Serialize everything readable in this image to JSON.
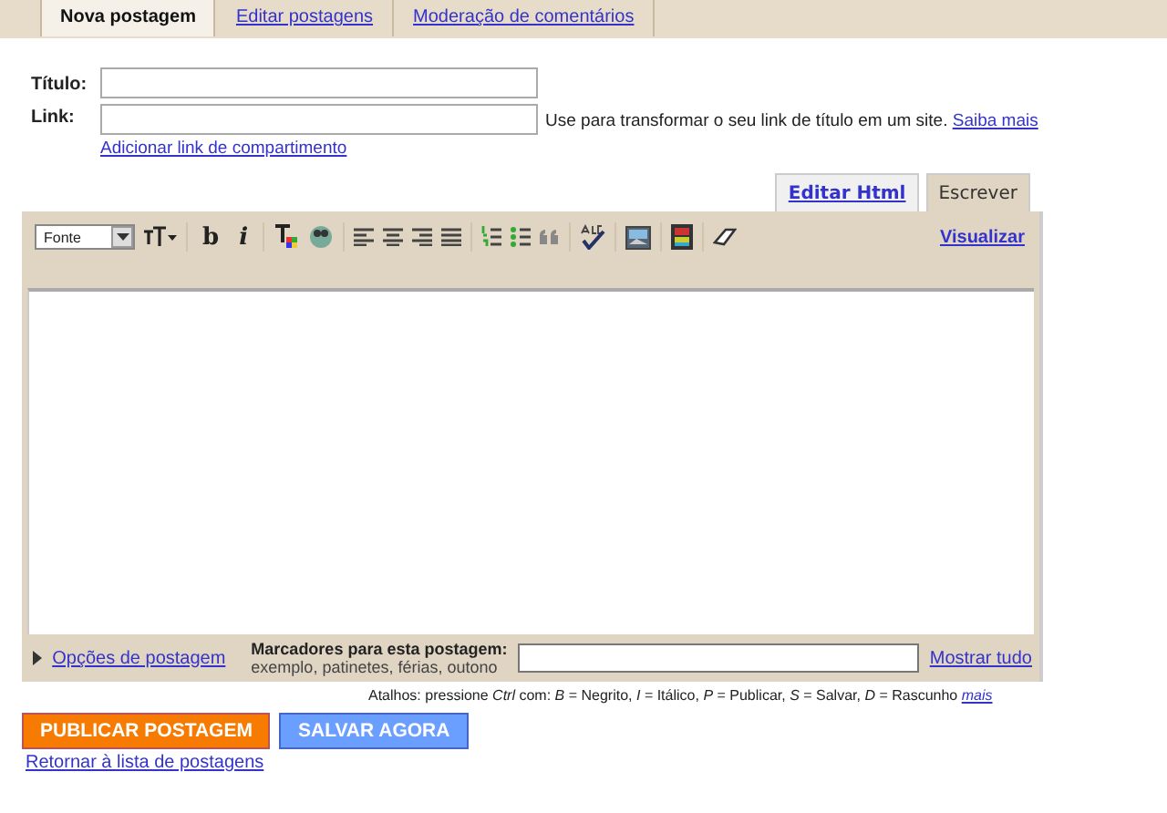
{
  "tabs": [
    {
      "label": "Nova postagem",
      "selected": true
    },
    {
      "label": "Editar postagens",
      "selected": false
    },
    {
      "label": "Moderação de comentários",
      "selected": false
    }
  ],
  "form": {
    "title_label": "Título:",
    "link_label": "Link:",
    "link_hint": "Use para transformar o seu link de título em um site.",
    "learn_more": "Saiba mais",
    "add_share_link": "Adicionar link de compartimento"
  },
  "editor_tabs": [
    {
      "label": "Editar Html",
      "selected": false
    },
    {
      "label": "Escrever",
      "selected": true
    }
  ],
  "toolbar": {
    "font_select": "Fonte",
    "bold": "b",
    "italic": "i",
    "preview": "Visualizar"
  },
  "options": {
    "post_options": "Opções de postagem",
    "labels_title": "Marcadores para esta postagem:",
    "labels_hint": "exemplo, patinetes, férias, outono",
    "show_all": "Mostrar tudo"
  },
  "shortcuts": {
    "text": "Atalhos: pressione *Ctrl* com: *B* = Negrito, *I* = Itálico, *P* = Publicar, *S* = Salvar, *D* = Rascunho",
    "more": "mais"
  },
  "buttons": [
    {
      "label": "PUBLICAR POSTAGEM",
      "kind": "publish"
    },
    {
      "label": "SALVAR AGORA",
      "kind": "save"
    }
  ],
  "back_link": "Retornar à lista de postagens"
}
